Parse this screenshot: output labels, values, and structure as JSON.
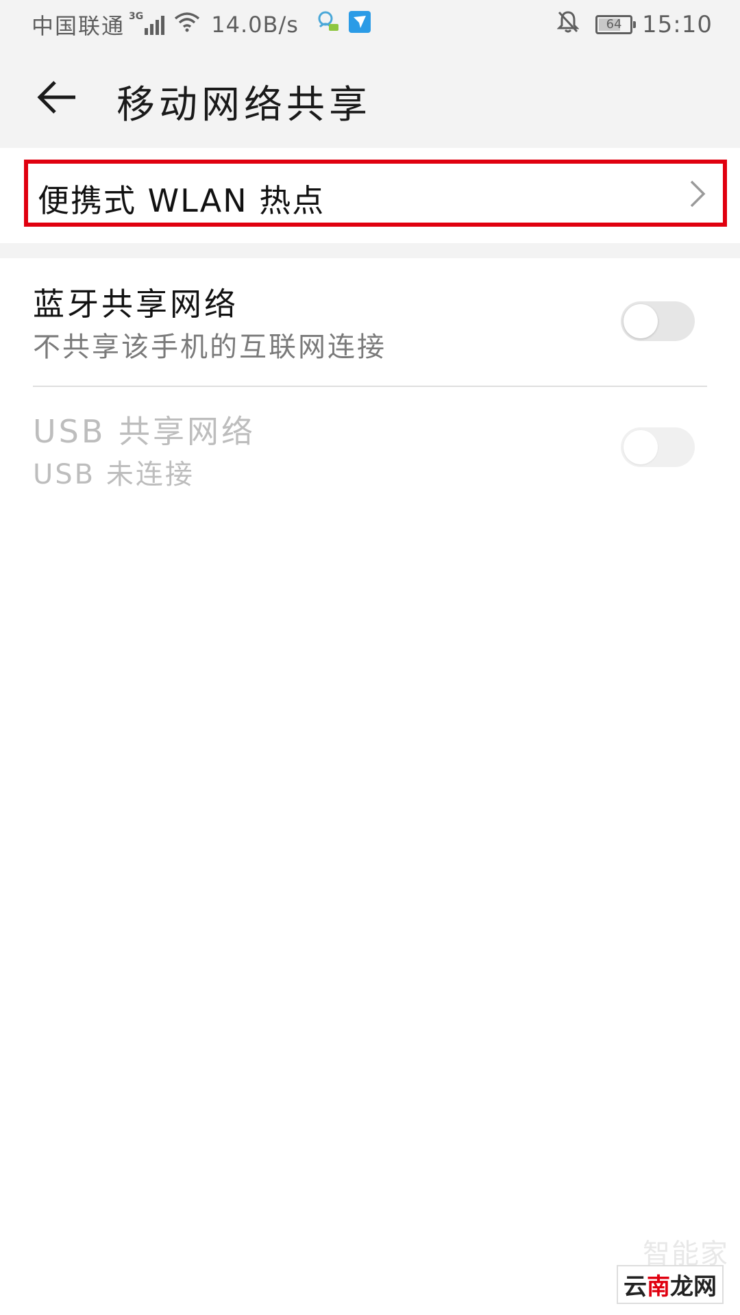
{
  "status_bar": {
    "carrier": "中国联通",
    "network_type": "3G",
    "net_speed": "14.0B/s",
    "battery_level": "64",
    "time": "15:10"
  },
  "app_bar": {
    "title": "移动网络共享"
  },
  "items": {
    "wlan_hotspot": {
      "label": "便携式 WLAN 热点"
    },
    "bluetooth": {
      "title": "蓝牙共享网络",
      "subtitle": "不共享该手机的互联网连接",
      "enabled": false
    },
    "usb": {
      "title": "USB 共享网络",
      "subtitle": "USB 未连接",
      "enabled": false,
      "disabled": true
    }
  },
  "colors": {
    "highlight": "#e0000f",
    "background": "#f3f3f3",
    "toggle_off": "#e6e6e6"
  },
  "watermark": {
    "faint": "智能家",
    "badge_part1": "云",
    "badge_part2": "南",
    "badge_part3": "龙网"
  }
}
